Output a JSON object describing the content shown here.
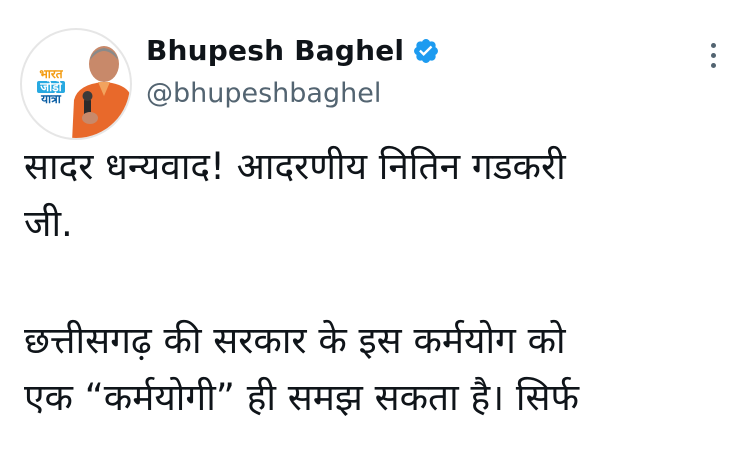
{
  "tweet": {
    "author": {
      "display_name": "Bhupesh Baghel",
      "handle": "@bhupeshbaghel",
      "verified": true,
      "avatar_badge": [
        "भारत",
        "जोड़ो",
        "यात्रा"
      ]
    },
    "menu_icon": "more-vertical-icon",
    "verified_icon": "verified-badge-icon",
    "text_lines": [
      "सादर धन्यवाद! आदरणीय नितिन गडकरी",
      "जी.",
      "",
      "छत्तीसगढ़ की सरकार के इस कर्मयोग को",
      "एक “कर्मयोगी” ही समझ सकता है। सिर्फ"
    ]
  },
  "colors": {
    "text": "#0f1419",
    "secondary_text": "#536471",
    "verified_blue": "#1d9bf0",
    "background": "#ffffff"
  }
}
